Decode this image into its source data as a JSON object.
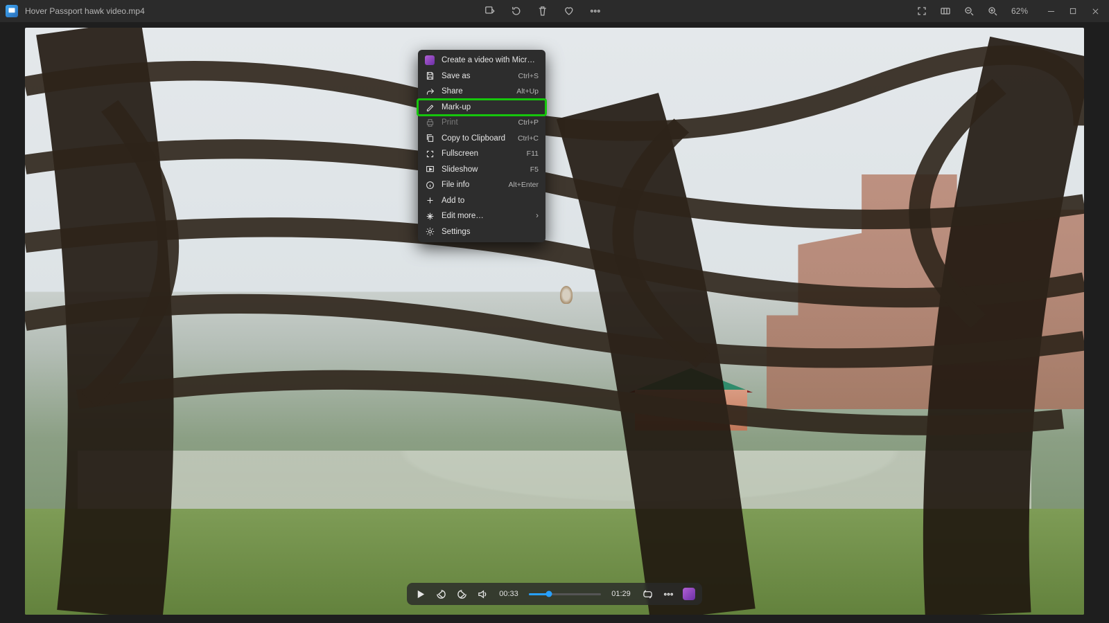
{
  "title": "Hover Passport hawk video.mp4",
  "zoom": "62%",
  "menu": {
    "items": [
      {
        "label": "Create a video with Microsoft Clipchamp",
        "shortcut": "",
        "icon": "clipchamp",
        "disabled": false,
        "highlight": false,
        "submenu": false
      },
      {
        "label": "Save as",
        "shortcut": "Ctrl+S",
        "icon": "save",
        "disabled": false,
        "highlight": false,
        "submenu": false
      },
      {
        "label": "Share",
        "shortcut": "Alt+Up",
        "icon": "share",
        "disabled": false,
        "highlight": false,
        "submenu": false
      },
      {
        "label": "Mark-up",
        "shortcut": "",
        "icon": "markup",
        "disabled": false,
        "highlight": true,
        "submenu": false
      },
      {
        "label": "Print",
        "shortcut": "Ctrl+P",
        "icon": "print",
        "disabled": true,
        "highlight": false,
        "submenu": false
      },
      {
        "label": "Copy to Clipboard",
        "shortcut": "Ctrl+C",
        "icon": "copy",
        "disabled": false,
        "highlight": false,
        "submenu": false
      },
      {
        "label": "Fullscreen",
        "shortcut": "F11",
        "icon": "fullscreen",
        "disabled": false,
        "highlight": false,
        "submenu": false
      },
      {
        "label": "Slideshow",
        "shortcut": "F5",
        "icon": "slideshow",
        "disabled": false,
        "highlight": false,
        "submenu": false
      },
      {
        "label": "File info",
        "shortcut": "Alt+Enter",
        "icon": "info",
        "disabled": false,
        "highlight": false,
        "submenu": false
      },
      {
        "label": "Add to",
        "shortcut": "",
        "icon": "add",
        "disabled": false,
        "highlight": false,
        "submenu": false
      },
      {
        "label": "Edit more…",
        "shortcut": "",
        "icon": "edit",
        "disabled": false,
        "highlight": false,
        "submenu": true
      },
      {
        "label": "Settings",
        "shortcut": "",
        "icon": "settings",
        "disabled": false,
        "highlight": false,
        "submenu": false
      }
    ]
  },
  "playback": {
    "current": "00:33",
    "duration": "01:29",
    "progress_pct": 28
  }
}
